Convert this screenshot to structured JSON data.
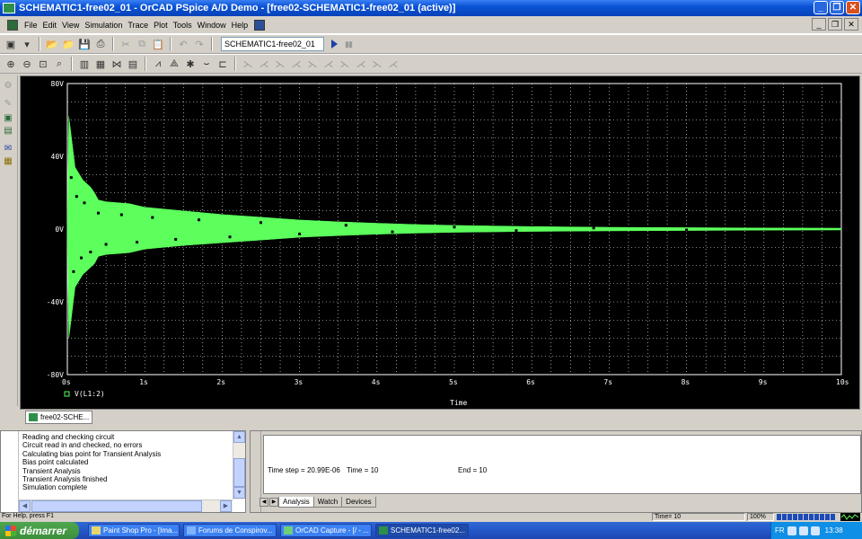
{
  "window": {
    "title": "SCHEMATIC1-free02_01 - OrCAD PSpice A/D Demo  - [free02-SCHEMATIC1-free02_01 (active)]"
  },
  "menu": [
    "File",
    "Edit",
    "View",
    "Simulation",
    "Trace",
    "Plot",
    "Tools",
    "Window",
    "Help"
  ],
  "toolbar": {
    "profile": "SCHEMATIC1-free02_01"
  },
  "document_tab": "free02-SCHE...",
  "output_log": [
    "Reading and checking circuit",
    "Circuit read in and checked, no errors",
    "Calculating bias point for Transient Analysis",
    "Bias point calculated",
    "Transient Analysis",
    "Transient Analysis finished",
    "Simulation complete"
  ],
  "sim_status": {
    "time_step": "Time step =  20.99E-06",
    "time": "Time = 10",
    "end": "End = 10"
  },
  "sim_tabs": [
    "Analysis",
    "Watch",
    "Devices"
  ],
  "statusbar": {
    "help": "For Help, press F1",
    "time": "Time= 10",
    "zoom": "100%",
    "progress": 1.0
  },
  "taskbar": {
    "start": "démarrer",
    "tasks": [
      "Paint Shop Pro - [Ima...",
      "Forums de Conspirov...",
      "OrCAD Capture - [/ - ...",
      "SCHEMATIC1-free02..."
    ],
    "active_task": 3,
    "lang": "FR",
    "clock": "13:38"
  },
  "colors": {
    "plot_background": "#000000",
    "trace": "#5cff5c",
    "titlebar": "#0a53d6",
    "taskbar": "#2456c8"
  },
  "chart_data": {
    "type": "area",
    "title": "",
    "xlabel": "Time",
    "ylabel": "",
    "x_ticks": [
      "0s",
      "1s",
      "2s",
      "3s",
      "4s",
      "5s",
      "6s",
      "7s",
      "8s",
      "9s",
      "10s"
    ],
    "y_ticks": [
      "80V",
      "40V",
      "0V",
      "-40V",
      "-80V"
    ],
    "xlim": [
      0,
      10
    ],
    "ylim": [
      -80,
      80
    ],
    "grid": true,
    "legend": "bottom-left",
    "series": [
      {
        "name": "V(L1:2)",
        "color": "#5cff5c",
        "envelope_time_s": [
          0.0,
          0.02,
          0.1,
          0.2,
          0.3,
          0.35,
          0.4,
          0.5,
          0.8,
          1.0,
          1.5,
          2.0,
          2.5,
          3.0,
          3.5,
          4.0,
          4.5,
          5.0,
          6.0,
          7.0,
          8.0,
          9.0,
          10.0
        ],
        "upper_V": [
          0,
          62,
          34,
          27,
          23,
          20,
          16,
          15,
          14,
          12,
          10,
          8,
          6.5,
          5,
          4,
          3.2,
          2.5,
          2,
          1.4,
          1,
          0.8,
          0.6,
          0.5
        ],
        "lower_V": [
          0,
          -60,
          -32,
          -25,
          -21,
          -19,
          -15,
          -14,
          -13,
          -11,
          -9,
          -7.5,
          -6,
          -4.5,
          -3.6,
          -2.8,
          -2.2,
          -1.8,
          -1.3,
          -1,
          -0.8,
          -0.6,
          -0.5
        ]
      }
    ]
  }
}
